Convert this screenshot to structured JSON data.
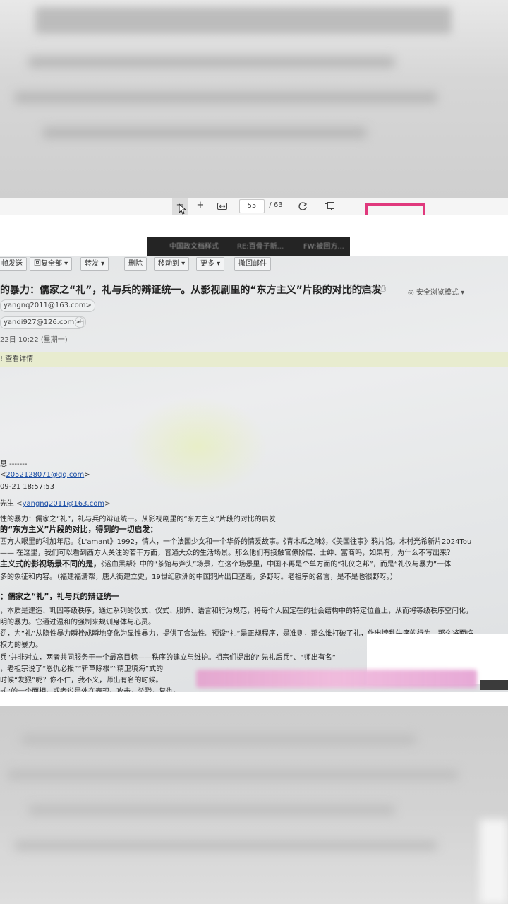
{
  "pdf_toolbar": {
    "zoom_out": "−",
    "zoom_in": "+",
    "current_page": "55",
    "total_pages": "/ 63"
  },
  "browser_tabs": [
    "中国政文档样式",
    "RE:百骨子新...",
    "FW:被回方..."
  ],
  "mail_toolbar": {
    "reply_send": "帧发送",
    "reply_all": "回复全部",
    "forward": "转发",
    "delete": "删除",
    "move_to": "移动到",
    "more": "更多",
    "recall": "撤回邮件"
  },
  "subject": "的暴力：儒家之“礼”，礼与兵的辩证统一。从影视剧里的“东方主义”片段的对比的启发",
  "safe_mode": "安全浏览模式",
  "addresses": {
    "sender": "yangnq2011@163.com>",
    "recipient": "yandi927@126.com>"
  },
  "date": "22日 10:22 (星期一)",
  "notice": "查看详情",
  "forwarded": {
    "header": "息 -------",
    "from_email": "2052128071@qq.com",
    "sent_time": "09-21 18:57:53",
    "to_label": "先生 <",
    "to_email": "yangnq2011@163.com",
    "subject_line": "性的暴力：儒家之“礼”，礼与兵的辩证统一。从影视剧里的“东方主义”片段的对比的启发"
  },
  "body": {
    "heading1": "的“东方主义”片段的对比，得到的一切启发：",
    "p1_l1": "西方人眼里的科加年尼。《L'amant》1992，情人，一个法国少女和一个华侨的情爱故事。《青木瓜之味》，《美国往事》鸦片馆。木村光希新片2024Tou",
    "p1_l2": "—— 在这里，我们可以看到西方人关注的若干方面，普通大众的生活场景。那么他们有接触官僚阶层、士绅、富商吗，如果有，为什么不写出来？",
    "heading2": "主义式的影视场景不同的是，",
    "p2_l1": "《浴血黑帮》中的“茶馆与斧头”场景，在这个场景里，中国不再是个单方面的“礼仪之邦”，而是“礼仪与暴力”一体",
    "p2_l2": "多的象征和内容。（福建福清帮，唐人街建立史，19世纪欧洲的中国鸦片出口垄断，多野呀。老祖宗的名言，是不是也很野呀。）",
    "heading3": "：儒家之“礼”，礼与兵的辩证统一",
    "p3_l1": "，本质是建造、巩固等级秩序，通过系列的仪式、仪式、服饰、语言和行为规范，将每个人固定在的社会结构中的特定位置上，从而将等级秩序空间化，",
    "p3_l2": "明的暴力。它通过温和的强制来规训身体与心灵。",
    "p3_l3": "罚，为“礼”从隐性暴力瞬挫成瞬地变化为显性暴力，提供了合法性。预设“礼”是正规程序，是准则，那么谁打破了礼，作出悖乱失序的行为，那么将面临",
    "p3_l4": "权力的暴力。",
    "p4_l1": "兵”并非对立，两者共同服务于一个最高目标——秩序的建立与维护。祖宗们提出的“先礼后兵”、“师出有名”",
    "p4_l2": "，老祖宗说了“恩仇必报”“斩草除根”“精卫填海”式的",
    "p4_l3": "时候“发狠”呢？你不仁，我不义，师出有名的时候。",
    "p4_l4": "式”的一个面相，或者说是外在表现。攻击，杀戮，复仇，"
  },
  "colors": {
    "accent_pink": "#e0397d",
    "link_blue": "#1d4fa5",
    "notice_bg": "#e8eccf"
  }
}
